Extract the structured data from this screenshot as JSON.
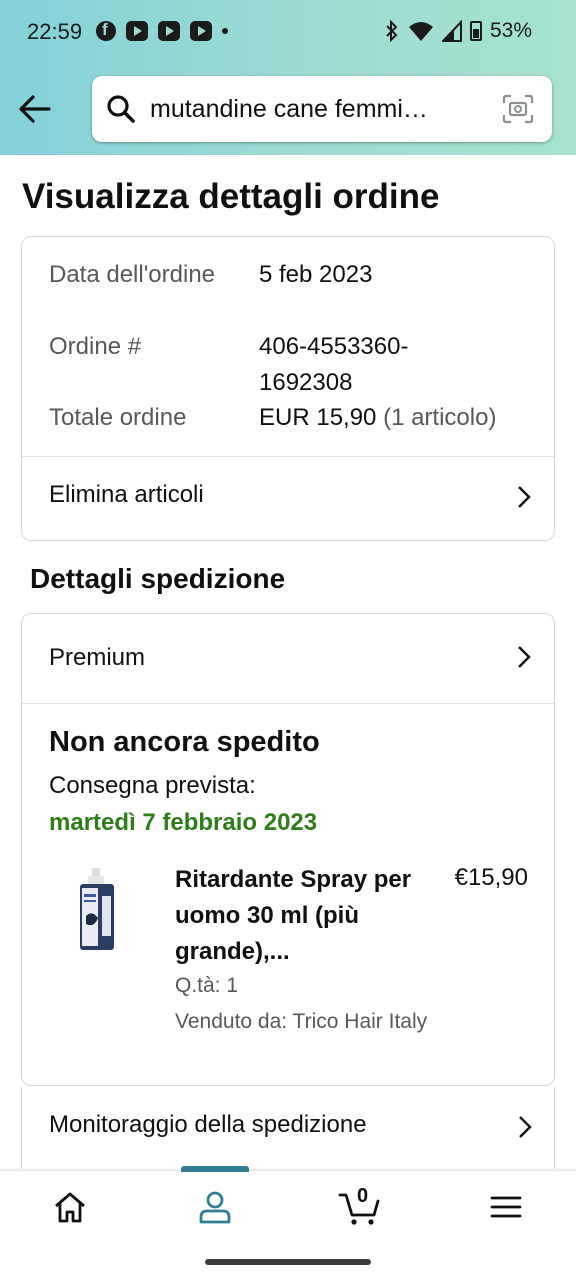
{
  "status_bar": {
    "time": "22:59",
    "battery": "53%",
    "notification_icons": [
      "facebook-icon",
      "youtube-icon",
      "youtube-icon",
      "youtube-icon"
    ]
  },
  "search": {
    "query": "mutandine cane femmi…"
  },
  "page": {
    "title": "Visualizza dettagli ordine"
  },
  "order_summary": {
    "date_label": "Data dell'ordine",
    "date_value": "5 feb 2023",
    "number_label": "Ordine #",
    "number_value": "406-4553360-1692308",
    "total_label": "Totale ordine",
    "total_value": "EUR 15,90",
    "total_items": "(1 articolo)",
    "delete_items_label": "Elimina articoli"
  },
  "shipping": {
    "section_title": "Dettagli spedizione",
    "tier": "Premium",
    "status": "Non ancora spedito",
    "delivery_label": "Consegna prevista:",
    "delivery_date": "martedì 7 febbraio 2023",
    "tracking_label": "Monitoraggio della spedizione"
  },
  "item": {
    "title": "Ritardante Spray per uomo 30 ml (più grande),...",
    "price": "€15,90",
    "quantity": "Q.tà: 1",
    "seller": "Venduto da: Trico Hair Italy"
  },
  "bottom_nav": {
    "cart_count": "0",
    "items": [
      "home-icon",
      "account-icon",
      "cart-icon",
      "menu-icon"
    ],
    "active": "account-icon"
  },
  "colors": {
    "accent_green": "#2e7d19",
    "nav_active": "#2f7e92",
    "header_gradient_start": "#83d1d8",
    "header_gradient_end": "#a6e2cf"
  }
}
